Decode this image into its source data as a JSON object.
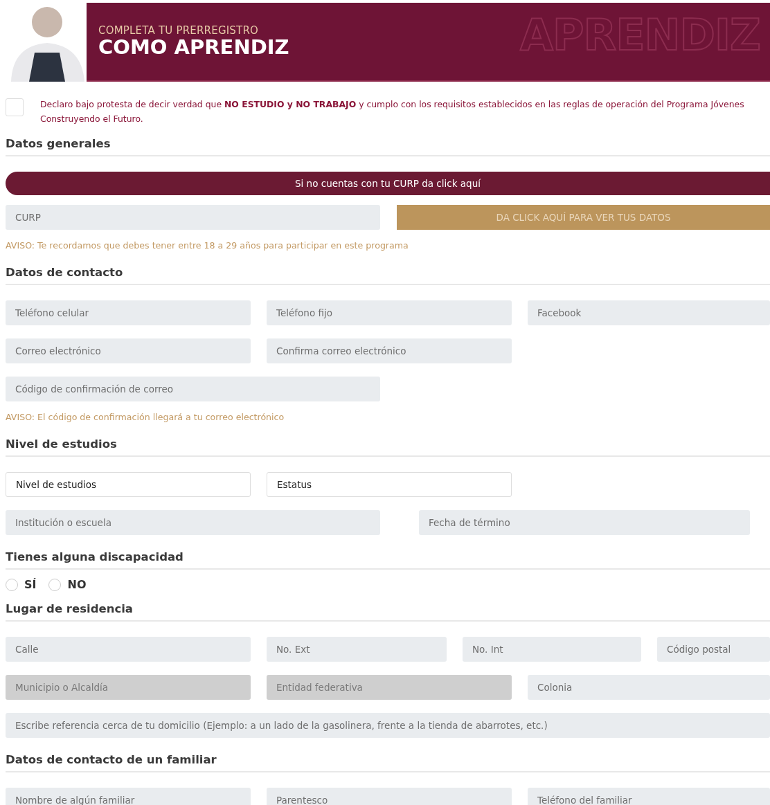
{
  "header": {
    "subtitle": "COMPLETA TU PRERREGISTRO",
    "title": "COMO APRENDIZ",
    "watermark": "APRENDIZ"
  },
  "declaration": {
    "checked": false,
    "text": "Declaro bajo protesta de decir verdad que **NO ESTUDIO y NO TRABAJO** y cumplo con los requisitos establecidos en las reglas de operación del Programa Jóvenes Construyendo el Futuro."
  },
  "sections": [
    {
      "title": "Datos generales",
      "blocks": [
        {
          "kind": "banner",
          "label": "Si no cuentas con tu CURP da click aquí"
        },
        {
          "kind": "fields",
          "fields": [
            {
              "kind": "input",
              "placeholder": "CURP",
              "disabled": false
            },
            {
              "kind": "action",
              "label": "DA CLICK AQUÍ PARA VER TUS DATOS"
            }
          ]
        },
        {
          "kind": "notice",
          "text": "AVISO: Te recordamos que debes tener entre 18 a 29 años para participar en este programa"
        }
      ]
    },
    {
      "title": "Datos de contacto",
      "blocks": [
        {
          "kind": "fields",
          "fields": [
            {
              "kind": "input",
              "placeholder": "Teléfono celular",
              "disabled": false
            },
            {
              "kind": "input",
              "placeholder": "Teléfono fijo",
              "disabled": false
            },
            {
              "kind": "input",
              "placeholder": "Facebook",
              "disabled": false
            }
          ]
        },
        {
          "kind": "fields",
          "fields": [
            {
              "kind": "input",
              "placeholder": "Correo electrónico",
              "disabled": false
            },
            {
              "kind": "input",
              "placeholder": "Confirma correo electrónico",
              "disabled": false
            }
          ]
        },
        {
          "kind": "fields",
          "fields": [
            {
              "kind": "input",
              "placeholder": "Código de confirmación de correo",
              "disabled": false
            }
          ]
        },
        {
          "kind": "notice",
          "text": "AVISO: El código de confirmación llegará a tu correo electrónico"
        }
      ]
    },
    {
      "title": "Nivel de estudios",
      "blocks": [
        {
          "kind": "fields",
          "fields": [
            {
              "kind": "select",
              "label": "Nivel de estudios"
            },
            {
              "kind": "select",
              "label": "Estatus"
            }
          ]
        },
        {
          "kind": "fields",
          "fields": [
            {
              "kind": "input",
              "placeholder": "Institución o escuela",
              "disabled": false
            },
            {
              "kind": "input",
              "placeholder": "Fecha de término",
              "disabled": false
            }
          ]
        }
      ]
    },
    {
      "title": "Tienes alguna discapacidad",
      "blocks": [
        {
          "kind": "radios",
          "options": [
            {
              "label": "SÍ",
              "selected": false
            },
            {
              "label": "NO",
              "selected": false
            }
          ]
        }
      ]
    },
    {
      "title": "Lugar de residencia",
      "blocks": [
        {
          "kind": "fields",
          "fields": [
            {
              "kind": "input",
              "placeholder": "Calle",
              "disabled": false
            },
            {
              "kind": "input",
              "placeholder": "No. Ext",
              "disabled": false
            },
            {
              "kind": "input",
              "placeholder": "No. Int",
              "disabled": false
            },
            {
              "kind": "input",
              "placeholder": "Código postal",
              "disabled": false
            }
          ]
        },
        {
          "kind": "fields",
          "fields": [
            {
              "kind": "input",
              "placeholder": "Municipio o Alcaldía",
              "disabled": true
            },
            {
              "kind": "input",
              "placeholder": "Entidad federativa",
              "disabled": true
            },
            {
              "kind": "input",
              "placeholder": "Colonia",
              "disabled": false
            }
          ]
        },
        {
          "kind": "fields",
          "fields": [
            {
              "kind": "input",
              "placeholder": "Escribe referencia cerca de tu domicilio (Ejemplo: a un lado de la gasolinera, frente a la tienda de abarrotes, etc.)",
              "disabled": false
            }
          ]
        }
      ]
    },
    {
      "title": "Datos de contacto de un familiar",
      "blocks": [
        {
          "kind": "fields",
          "fields": [
            {
              "kind": "input",
              "placeholder": "Nombre de algún familiar",
              "disabled": false
            },
            {
              "kind": "input",
              "placeholder": "Parentesco",
              "disabled": false
            },
            {
              "kind": "input",
              "placeholder": "Teléfono del familiar",
              "disabled": false
            }
          ]
        }
      ]
    }
  ]
}
